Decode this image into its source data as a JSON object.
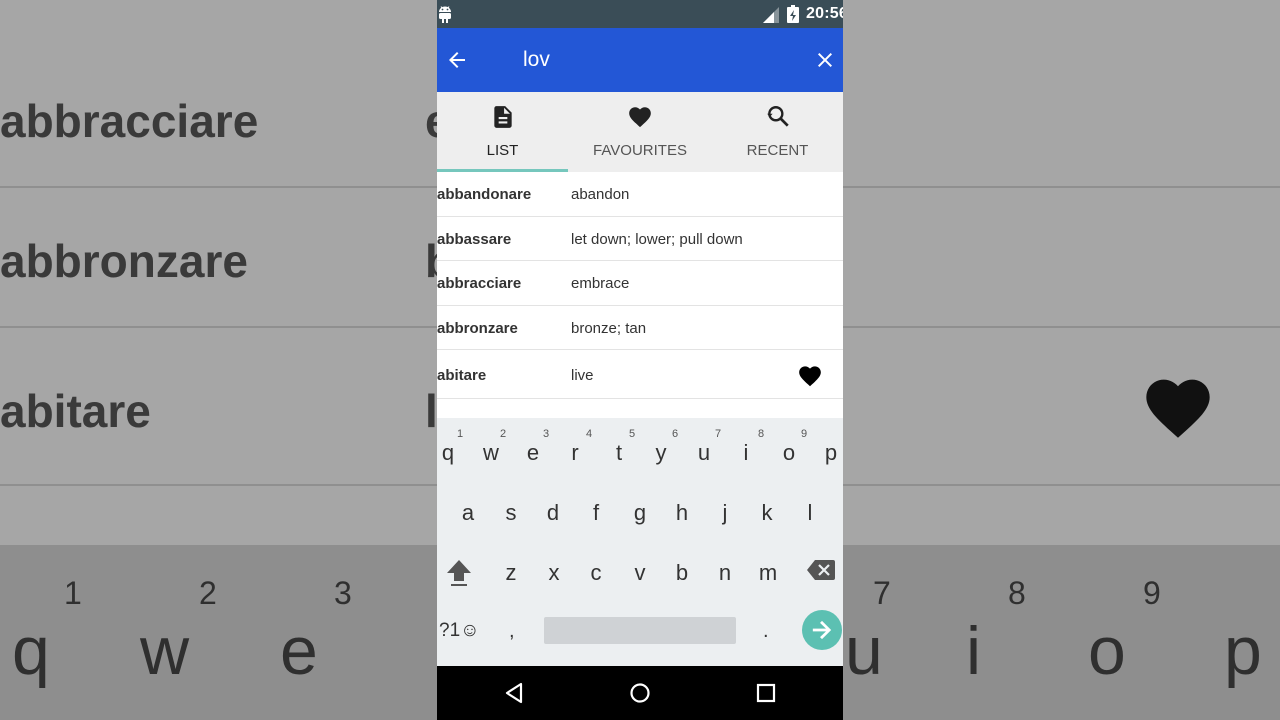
{
  "status_bar": {
    "time": "20:56"
  },
  "app_bar": {
    "search_query": "lov"
  },
  "tabs": [
    {
      "label": "LIST",
      "icon": "document-icon",
      "active": true
    },
    {
      "label": "FAVOURITES",
      "icon": "heart-icon",
      "active": false
    },
    {
      "label": "RECENT",
      "icon": "search-history-icon",
      "active": false
    }
  ],
  "list": [
    {
      "italian": "abbandonare",
      "english": "abandon",
      "favourite": false
    },
    {
      "italian": "abbassare",
      "english": "let down; lower; pull down",
      "favourite": false
    },
    {
      "italian": "abbracciare",
      "english": "embrace",
      "favourite": false
    },
    {
      "italian": "abbronzare",
      "english": "bronze; tan",
      "favourite": false
    },
    {
      "italian": "abitare",
      "english": "live",
      "favourite": true
    }
  ],
  "keyboard": {
    "row1": [
      "q",
      "w",
      "e",
      "r",
      "t",
      "y",
      "u",
      "i",
      "o",
      "p"
    ],
    "row1_numbers": [
      "1",
      "2",
      "3",
      "4",
      "5",
      "6",
      "7",
      "8",
      "9"
    ],
    "row2": [
      "a",
      "s",
      "d",
      "f",
      "g",
      "h",
      "j",
      "k",
      "l"
    ],
    "row3": [
      "z",
      "x",
      "c",
      "v",
      "b",
      "n",
      "m"
    ],
    "symbols_key": "?1☺",
    "comma_key": ",",
    "period_key": "."
  },
  "background": {
    "rows": [
      "abbracciare",
      "abbronzare",
      "abitare"
    ],
    "row_fragments": [
      "e",
      "b",
      "l"
    ],
    "numbers": [
      "1",
      "2",
      "3",
      "7",
      "8",
      "9"
    ],
    "keys": [
      "q",
      "w",
      "e",
      "u",
      "i",
      "o",
      "p"
    ]
  },
  "colors": {
    "app_bar": "#2357d6",
    "status_bar": "#3a4d57",
    "tab_underline": "#76c7bd",
    "go_button": "#5cc0b2"
  }
}
